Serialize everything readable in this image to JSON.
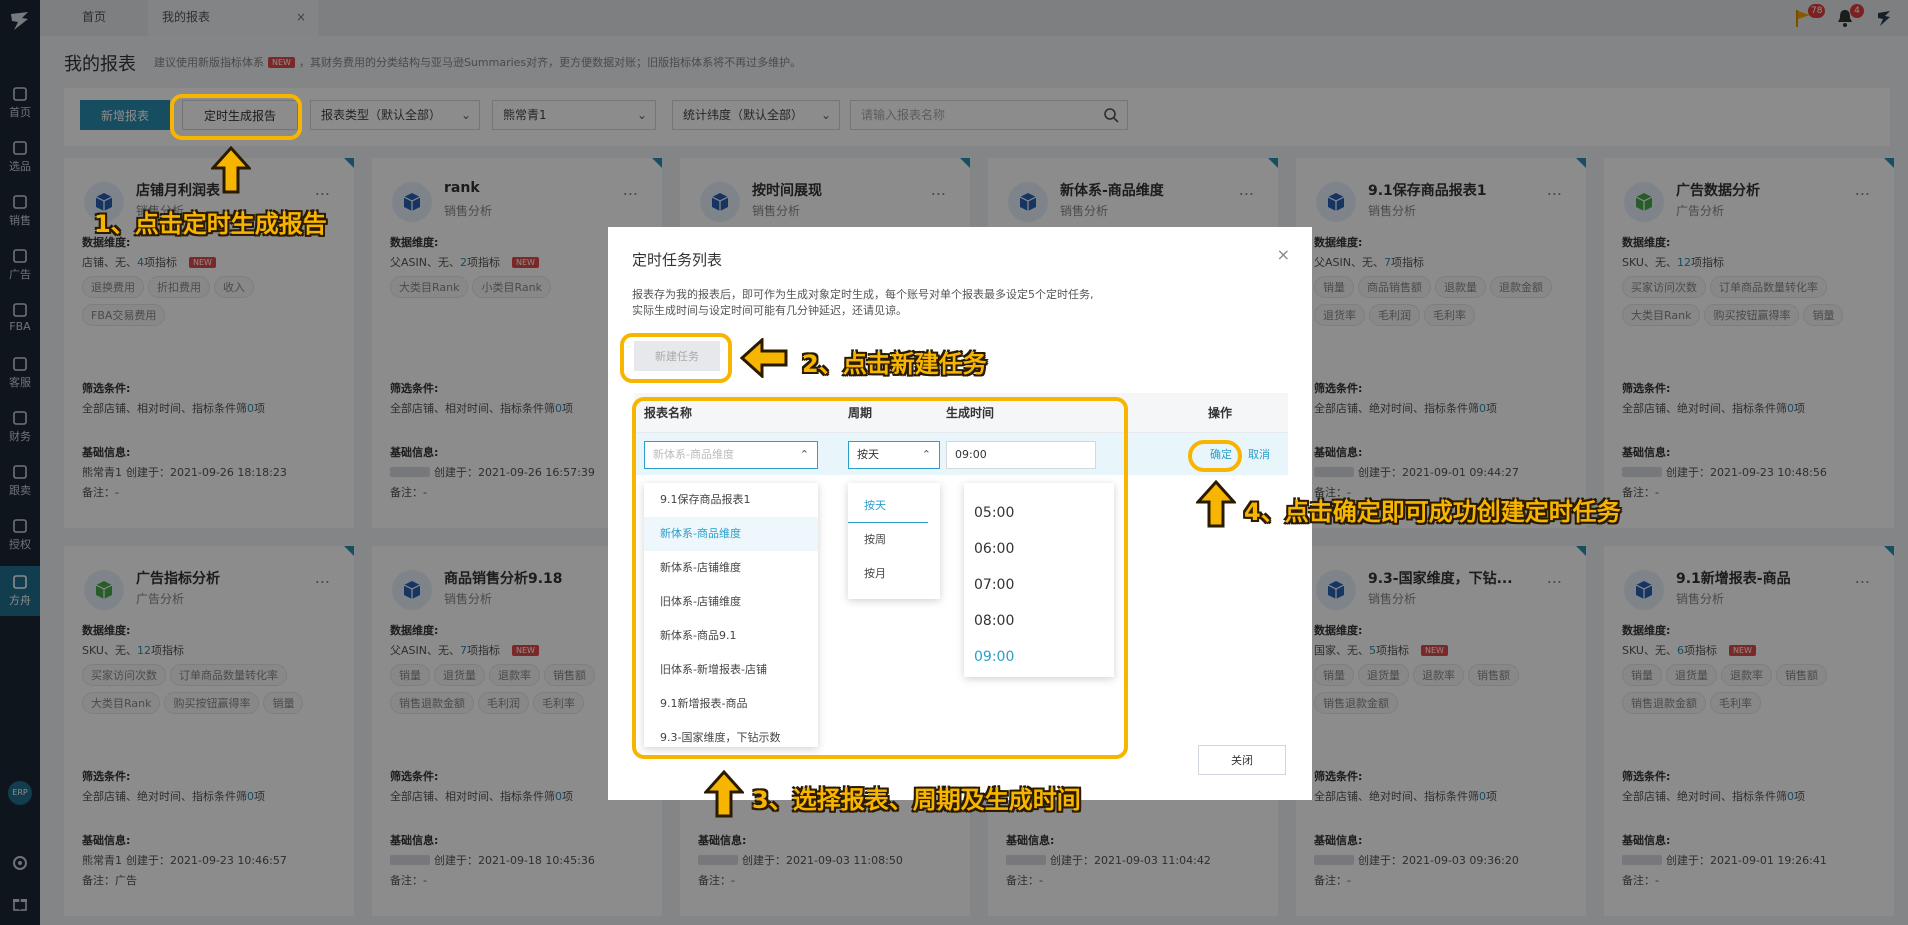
{
  "sidebar": {
    "items": [
      {
        "label": "首页",
        "icon": "home-icon"
      },
      {
        "label": "选品",
        "icon": "search-icon"
      },
      {
        "label": "销售",
        "icon": "chart-line-icon"
      },
      {
        "label": "广告",
        "icon": "ad-icon"
      },
      {
        "label": "FBA",
        "icon": "fba-icon"
      },
      {
        "label": "客服",
        "icon": "service-icon"
      },
      {
        "label": "财务",
        "icon": "finance-icon"
      },
      {
        "label": "跟卖",
        "icon": "pie-icon"
      },
      {
        "label": "授权",
        "icon": "shield-icon"
      },
      {
        "label": "方舟",
        "icon": "ark-icon"
      }
    ],
    "erp_label": "ERP"
  },
  "topbar": {
    "tabs": [
      {
        "label": "首页"
      },
      {
        "label": "我的报表"
      }
    ],
    "close_glyph": "×",
    "flag_badge": "78",
    "bell_badge": "4"
  },
  "page": {
    "title": "我的报表",
    "note_before": "建议使用新版指标体系",
    "new_badge": "NEW",
    "note_after": "，其财务费用的分类结构与亚马逊Summaries对齐，更方便数据对账；旧版指标体系将不再过多维护。"
  },
  "toolbar": {
    "new_report": "新增报表",
    "timed_report": "定时生成报告",
    "type_select": "报表类型（默认全部）",
    "account_select": "熊常青1",
    "dimension_select": "统计纬度（默认全部）",
    "search_placeholder": "请输入报表名称"
  },
  "labels": {
    "data_dim": "数据维度:",
    "filter": "筛选条件:",
    "basic": "基础信息:",
    "more": "...",
    "ellipsis": "..."
  },
  "cards": [
    {
      "title": "店铺月利润表",
      "sub": "销售分析",
      "dim_pre": "店铺、无、",
      "dim_num": "4",
      "dim_post": "项指标",
      "new": true,
      "tags": [
        "退换费用",
        "折扣费用",
        "收入",
        "FBA交易费用"
      ],
      "filter_pre": "全部店铺、相对时间、指标条件筛",
      "filter_num": "0",
      "filter_post": "项",
      "owner": "熊常青1",
      "created": "创建于：2021-09-26 18:18:23",
      "remark": "备注：-",
      "color": "#2b62b5"
    },
    {
      "title": "rank",
      "sub": "销售分析",
      "dim_pre": "父ASIN、无、",
      "dim_num": "2",
      "dim_post": "项指标",
      "new": true,
      "tags": [
        "大类目Rank",
        "小类目Rank"
      ],
      "filter_pre": "全部店铺、相对时间、指标条件筛",
      "filter_num": "0",
      "filter_post": "项",
      "owner": "",
      "created": "创建于：2021-09-26 16:57:39",
      "remark": "备注：-",
      "color": "#2b62b5"
    },
    {
      "title": "按时间展现",
      "sub": "销售分析",
      "color": "#2b62b5"
    },
    {
      "title": "新体系-商品维度",
      "sub": "销售分析",
      "color": "#2b62b5"
    },
    {
      "title": "9.1保存商品报表1",
      "sub": "销售分析",
      "dim_pre": "父ASIN、无、",
      "dim_num": "7",
      "dim_post": "项指标",
      "new": false,
      "tags": [
        "销量",
        "商品销售额",
        "退款量",
        "退款金额",
        "退货率",
        "毛利润",
        "毛利率"
      ],
      "filter_pre": "全部店铺、绝对时间、指标条件筛",
      "filter_num": "0",
      "filter_post": "项",
      "owner": "",
      "created": "创建于：2021-09-01 09:44:27",
      "remark": "备注：-",
      "color": "#2b62b5"
    },
    {
      "title": "广告数据分析",
      "sub": "广告分析",
      "dim_pre": "SKU、无、",
      "dim_num": "12",
      "dim_post": "项指标",
      "new": false,
      "tags": [
        "买家访问次数",
        "订单商品数量转化率",
        "大类目Rank",
        "购买按钮赢得率",
        "销量"
      ],
      "filter_pre": "全部店铺、绝对时间、指标条件筛",
      "filter_num": "0",
      "filter_post": "项",
      "owner": "",
      "created": "创建于：2021-09-23 10:48:56",
      "remark": "备注：-",
      "color": "#4aa84a"
    },
    {
      "title": "广告指标分析",
      "sub": "广告分析",
      "dim_pre": "SKU、无、",
      "dim_num": "12",
      "dim_post": "项指标",
      "new": false,
      "tags": [
        "买家访问次数",
        "订单商品数量转化率",
        "大类目Rank",
        "购买按钮赢得率",
        "销量"
      ],
      "filter_pre": "全部店铺、绝对时间、指标条件筛",
      "filter_num": "0",
      "filter_post": "项",
      "owner": "熊常青1",
      "created": "创建于：2021-09-23 10:46:57",
      "remark": "备注：广告",
      "color": "#4aa84a"
    },
    {
      "title": "商品销售分析9.18",
      "sub": "销售分析",
      "dim_pre": "父ASIN、无、",
      "dim_num": "7",
      "dim_post": "项指标",
      "new": true,
      "tags": [
        "销量",
        "退货量",
        "退款率",
        "销售额",
        "销售退款金额",
        "毛利润",
        "毛利率"
      ],
      "filter_pre": "全部店铺、相对时间、指标条件筛",
      "filter_num": "0",
      "filter_post": "项",
      "owner": "",
      "created": "创建于：2021-09-18 10:45:36",
      "remark": "备注：-",
      "color": "#2b62b5"
    },
    {
      "title": "",
      "sub": "",
      "owner": "",
      "created": "创建于：2021-09-03 11:08:50",
      "remark": "备注：-",
      "color": "#2b62b5"
    },
    {
      "title": "",
      "sub": "",
      "owner": "",
      "created": "创建于：2021-09-03 11:04:42",
      "remark": "备注：-",
      "color": "#2b62b5"
    },
    {
      "title": "9.3-国家维度，下钻...",
      "sub": "销售分析",
      "dim_pre": "国家、无、",
      "dim_num": "5",
      "dim_post": "项指标",
      "new": true,
      "tags": [
        "销量",
        "退货量",
        "退款率",
        "销售额",
        "销售退款金额"
      ],
      "filter_pre": "全部店铺、绝对时间、指标条件筛",
      "filter_num": "0",
      "filter_post": "项",
      "owner": "",
      "created": "创建于：2021-09-03 09:36:20",
      "remark": "备注：-",
      "color": "#2b62b5"
    },
    {
      "title": "9.1新增报表-商品",
      "sub": "销售分析",
      "dim_pre": "SKU、无、",
      "dim_num": "6",
      "dim_post": "项指标",
      "new": true,
      "tags": [
        "销量",
        "退货量",
        "退款率",
        "销售额",
        "销售退款金额",
        "毛利率"
      ],
      "filter_pre": "全部店铺、绝对时间、指标条件筛",
      "filter_num": "0",
      "filter_post": "项",
      "owner": "",
      "created": "创建于：2021-09-01 19:26:41",
      "remark": "备注：-",
      "color": "#2b62b5"
    }
  ],
  "modal": {
    "title": "定时任务列表",
    "close_glyph": "×",
    "desc1": "报表存为我的报表后，即可作为生成对象定时生成，每个账号对单个报表最多设定5个定时任务,",
    "desc2": "实际生成时间与设定时间可能有几分钟延迟，还请见谅。",
    "new_task": "新建任务",
    "headers": {
      "name": "报表名称",
      "period": "周期",
      "time": "生成时间",
      "op": "操作"
    },
    "name_value": "新体系-商品维度",
    "period_value": "按天",
    "time_value": "09:00",
    "ok": "确定",
    "cancel": "取消",
    "close_btn": "关闭",
    "report_options": [
      "9.1保存商品报表1",
      "新体系-商品维度",
      "新体系-店铺维度",
      "旧体系-店铺维度",
      "新体系-商品9.1",
      "旧体系-新增报表-店铺",
      "9.1新增报表-商品",
      "9.3-国家维度，下钻示数"
    ],
    "period_options": [
      "按天",
      "按周",
      "按月"
    ],
    "time_options": [
      "05:00",
      "06:00",
      "07:00",
      "08:00",
      "09:00"
    ]
  },
  "annotations": {
    "step1": "1、点击定时生成报告",
    "step2": "2、点击新建任务",
    "step3": "3、选择报表、周期及生成时间",
    "step4": "4、点击确定即可成功创建定时任务"
  }
}
